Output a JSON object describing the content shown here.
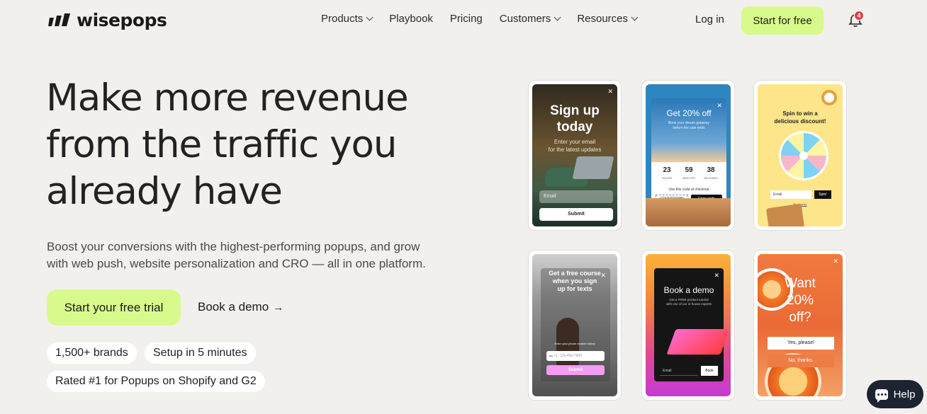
{
  "nav": {
    "logo": "wisepops",
    "menu": [
      {
        "label": "Products",
        "dropdown": true
      },
      {
        "label": "Playbook",
        "dropdown": false
      },
      {
        "label": "Pricing",
        "dropdown": false
      },
      {
        "label": "Customers",
        "dropdown": true
      },
      {
        "label": "Resources",
        "dropdown": true
      }
    ],
    "login": "Log in",
    "cta": "Start for free",
    "notification_count": "4"
  },
  "hero": {
    "headline_line1": "Make more revenue",
    "headline_line2": "from the traffic you",
    "headline_line3": "already have",
    "subtext_line1": "Boost your conversions with the highest-performing popups, and grow",
    "subtext_line2": "with web push, website personalization and CRO — all in one platform.",
    "primary_cta": "Start your free trial",
    "secondary_cta": "Book a demo",
    "pills": [
      "1,500+ brands",
      "Setup in 5 minutes",
      "Rated #1 for Popups on Shopify and G2"
    ]
  },
  "cards": {
    "signup": {
      "title_line1": "Sign up",
      "title_line2": "today",
      "sub_line1": "Enter your email",
      "sub_line2": "for the latest updates",
      "email_placeholder": "Email",
      "button": "Submit"
    },
    "countdown": {
      "title": "Get 20% off",
      "sub_line1": "Book your dream getaway",
      "sub_line2": "before the sale ends",
      "hours": "23",
      "minutes": "59",
      "seconds": "38",
      "hours_label": "HOURS",
      "minutes_label": "MINUTES",
      "seconds_label": "SECONDS",
      "code_label": "Use this code at checkout",
      "code": "COUNTDOWN",
      "copy": "Copy code"
    },
    "spin": {
      "title_line1": "Spin to win a",
      "title_line2": "delicious discount!",
      "email_placeholder": "Email",
      "button": "Spin!",
      "no_thanks": "No, thanks"
    },
    "course": {
      "title_line1": "Get a free course",
      "title_line2": "when you sign",
      "title_line3": "up for texts",
      "phone_label": "Enter your phone number below",
      "phone_code": "+1",
      "phone_placeholder": "123-456-7890",
      "button": "Submit"
    },
    "demo": {
      "title": "Book a demo",
      "sub_line1": "Get a FREE product tutorial",
      "sub_line2": "with one of our in-house experts",
      "email_placeholder": "Email",
      "button": "Book"
    },
    "discount": {
      "title_line1": "Want",
      "title_line2": "20%",
      "title_line3": "off?",
      "yes": "Yes, please!",
      "no": "No, thanks."
    }
  },
  "help": {
    "label": "Help"
  },
  "colors": {
    "accent": "#d8fa8c",
    "background": "#f2f0ec",
    "badge": "#e33a3a",
    "help_bg": "#1d2330"
  }
}
